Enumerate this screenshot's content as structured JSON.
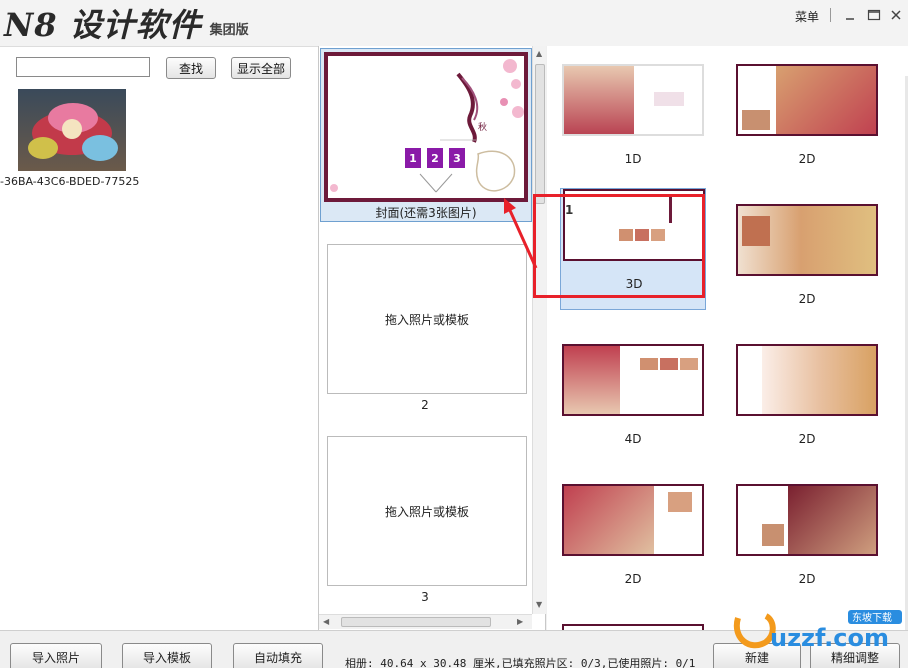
{
  "app": {
    "logo_main": "N8 设计软件",
    "logo_sub": "集团版",
    "menu_label": "菜单"
  },
  "left": {
    "search_placeholder": "",
    "search_button": "查找",
    "show_all_button": "显示全部",
    "photo_name": "-36BA-43C6-BDED-77525"
  },
  "middle": {
    "cover_caption": "封面(还需3张图片)",
    "slots": [
      "1",
      "2",
      "3"
    ],
    "pages": [
      {
        "hint": "拖入照片或模板",
        "number": "2"
      },
      {
        "hint": "拖入照片或模板",
        "number": "3"
      }
    ]
  },
  "right": {
    "selected_badge": "1",
    "templates": [
      {
        "label": "1D"
      },
      {
        "label": "2D"
      },
      {
        "label": "3D"
      },
      {
        "label": "2D"
      },
      {
        "label": "4D"
      },
      {
        "label": "2D"
      },
      {
        "label": "2D"
      },
      {
        "label": "2D"
      }
    ]
  },
  "bottom": {
    "import_photo": "导入照片",
    "import_template": "导入模板",
    "auto_fill": "自动填充",
    "status": "相册: 40.64 x 30.48 厘米,已填充照片区: 0/3,已使用照片: 0/1",
    "new": "新建",
    "fine_adjust": "精细调整"
  },
  "watermark": "uzzf.com",
  "watermark_badge": "东坡下载",
  "colors": {
    "accent_frame": "#6d1a3a",
    "slot_purple": "#8a1aa8",
    "highlight_red": "#e8212a",
    "selection_blue": "#d5e5f7"
  }
}
